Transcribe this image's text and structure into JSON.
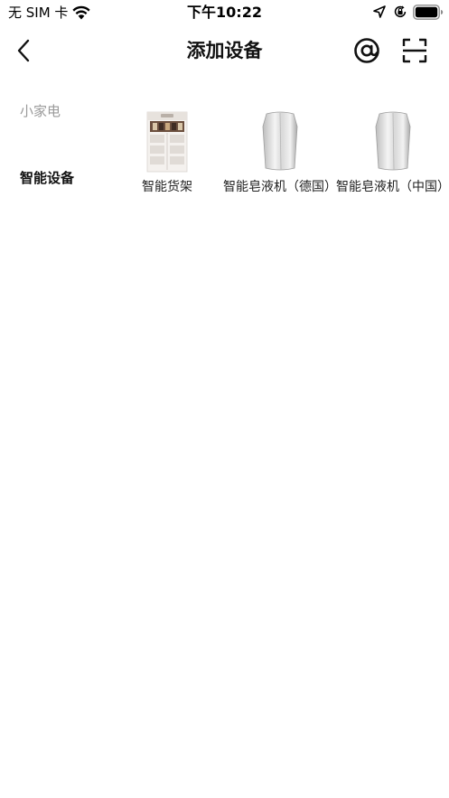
{
  "status_bar": {
    "carrier": "无 SIM 卡",
    "time": "下午10:22",
    "icons": [
      "wifi-icon",
      "location-arrow-icon",
      "orientation-lock-icon",
      "battery-icon"
    ]
  },
  "nav": {
    "title": "添加设备",
    "icons": [
      "chevron-left-icon",
      "at-sign-icon",
      "scan-icon"
    ]
  },
  "categories": [
    {
      "label": "小家电",
      "selected": false
    },
    {
      "label": "智能设备",
      "selected": true
    }
  ],
  "devices": [
    {
      "label": "智能货架",
      "icon": "smart-shelf-image"
    },
    {
      "label": "智能皂液机（德国）",
      "icon": "soap-dispenser-image"
    },
    {
      "label": "智能皂液机（中国）",
      "icon": "soap-dispenser-image"
    }
  ],
  "colors": {
    "text_primary": "#111111",
    "text_inactive": "#9a9a9a",
    "background": "#ffffff"
  }
}
